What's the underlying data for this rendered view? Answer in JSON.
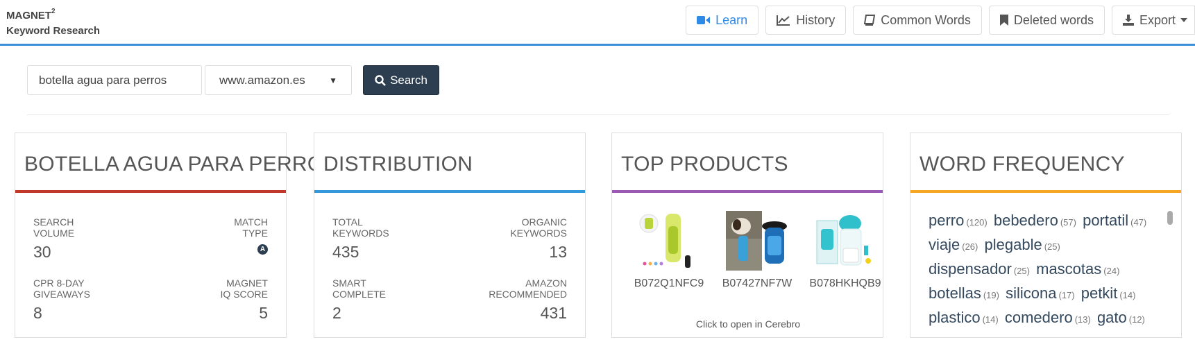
{
  "header": {
    "brand_name": "MAGNET",
    "brand_sup": "2",
    "brand_sub": "Keyword Research",
    "nav": {
      "learn": "Learn",
      "history": "History",
      "common": "Common Words",
      "deleted": "Deleted words",
      "export": "Export"
    },
    "icons": [
      "video-camera-icon",
      "line-chart-icon",
      "book-icon",
      "bookmark-icon",
      "download-icon"
    ]
  },
  "search": {
    "query": "botella agua para perros",
    "domain": "www.amazon.es",
    "button": "Search"
  },
  "panels": {
    "keyword": {
      "title": "BOTELLA AGUA PARA PERROS",
      "search_volume_label1": "SEARCH",
      "search_volume_label2": "VOLUME",
      "search_volume": "30",
      "match_type_label1": "MATCH",
      "match_type_label2": "TYPE",
      "match_type_badge": "A",
      "cpr_label1": "CPR 8-DAY",
      "cpr_label2": "GIVEAWAYS",
      "cpr": "8",
      "iq_label1": "MAGNET",
      "iq_label2": "IQ SCORE",
      "iq": "5"
    },
    "distribution": {
      "title": "DISTRIBUTION",
      "total_label1": "TOTAL",
      "total_label2": "KEYWORDS",
      "total": "435",
      "organic_label1": "ORGANIC",
      "organic_label2": "KEYWORDS",
      "organic": "13",
      "smart_label1": "SMART",
      "smart_label2": "COMPLETE",
      "smart": "2",
      "amazon_label1": "AMAZON",
      "amazon_label2": "RECOMMENDED",
      "amazon": "431"
    },
    "products": {
      "title": "TOP PRODUCTS",
      "items": [
        "B072Q1NFC9",
        "B07427NF7W",
        "B078HKHQB9"
      ],
      "footer": "Click to open in Cerebro"
    },
    "words": {
      "title": "WORD FREQUENCY",
      "items": [
        {
          "word": "perro",
          "count": "(120)"
        },
        {
          "word": "bebedero",
          "count": "(57)"
        },
        {
          "word": "portatil",
          "count": "(47)"
        },
        {
          "word": "viaje",
          "count": "(26)"
        },
        {
          "word": "plegable",
          "count": "(25)"
        },
        {
          "word": "dispensador",
          "count": "(25)"
        },
        {
          "word": "mascotas",
          "count": "(24)"
        },
        {
          "word": "botellas",
          "count": "(19)"
        },
        {
          "word": "silicona",
          "count": "(17)"
        },
        {
          "word": "petkit",
          "count": "(14)"
        },
        {
          "word": "plastico",
          "count": "(14)"
        },
        {
          "word": "comedero",
          "count": "(13)"
        },
        {
          "word": "gato",
          "count": "(12)"
        }
      ]
    }
  },
  "colors": {
    "accent_blue": "#3b8fd9",
    "keyword_red": "#c0392b",
    "distribution_blue": "#3498db",
    "products_purple": "#9b59b6",
    "words_orange": "#f5a623",
    "dark_navy": "#2c3e50"
  }
}
